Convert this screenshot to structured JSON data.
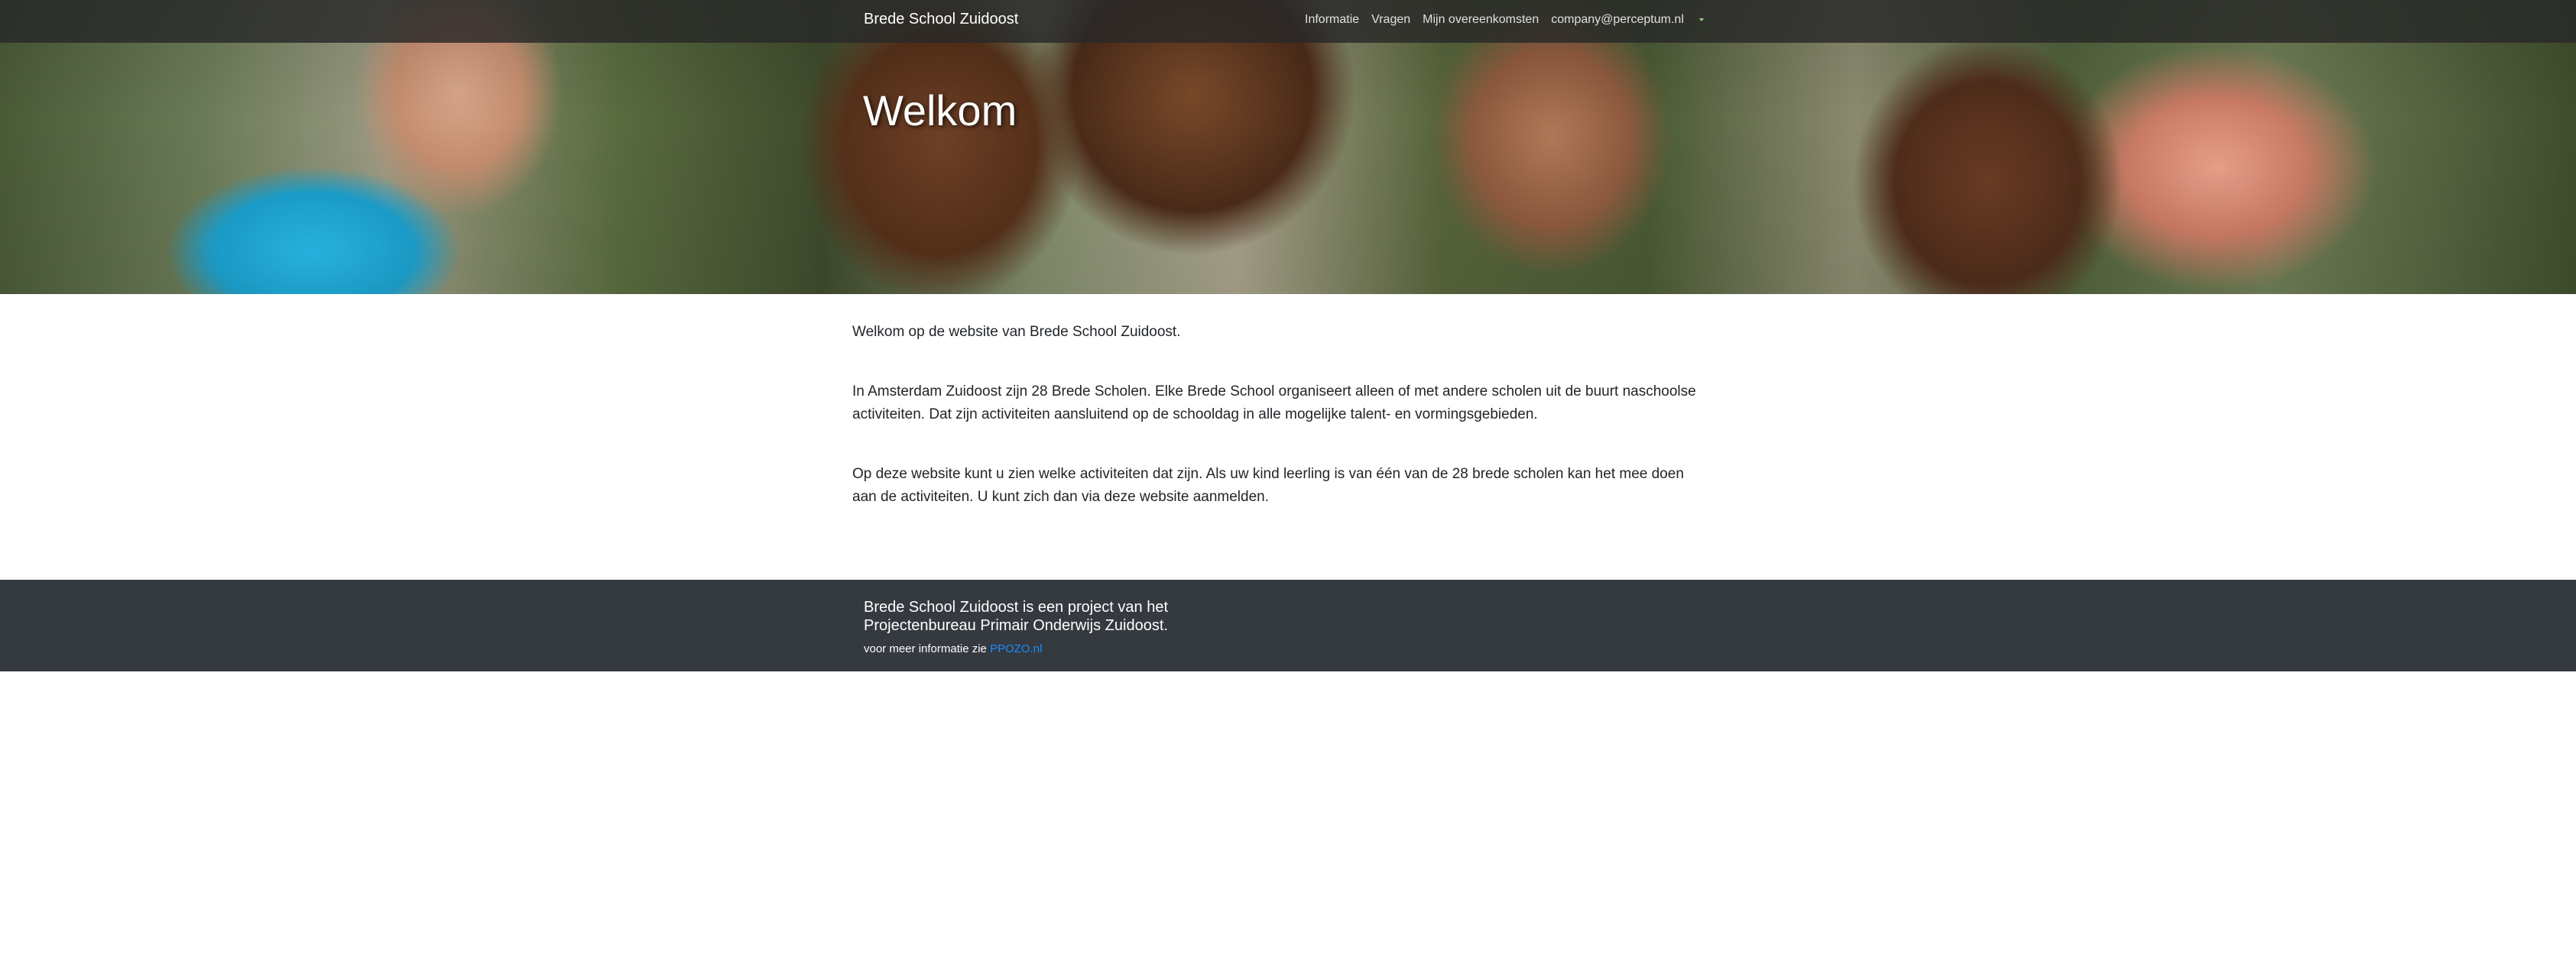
{
  "navbar": {
    "brand": "Brede School Zuidoost",
    "links": [
      {
        "label": "Informatie"
      },
      {
        "label": "Vragen"
      },
      {
        "label": "Mijn overeenkomsten"
      },
      {
        "label": "company@perceptum.nl"
      }
    ]
  },
  "hero": {
    "title": "Welkom"
  },
  "content": {
    "paragraphs": [
      "Welkom op de website van Brede School Zuidoost.",
      "In Amsterdam Zuidoost zijn 28 Brede Scholen. Elke Brede School organiseert alleen of met andere scholen uit de buurt naschoolse activiteiten. Dat zijn activiteiten aansluitend op de schooldag in alle mogelijke talent- en vormingsgebieden.",
      "Op deze website kunt u zien welke activiteiten dat zijn. Als uw kind leerling is van één van de 28 brede scholen kan het mee doen aan de activiteiten. U kunt zich dan via deze website aanmelden."
    ]
  },
  "footer": {
    "text": "Brede School Zuidoost is een project van het Projectenbureau Primair Onderwijs Zuidoost.",
    "more_info_prefix": "voor meer informatie zie",
    "link_label": "PPOZO.nl"
  },
  "colors": {
    "navbar_bg": "#282828",
    "footer_bg": "#343a40",
    "link_blue": "#1a8cff",
    "caret_green": "#8fe07a"
  },
  "icons": {
    "user_menu": "caret-down-icon"
  }
}
